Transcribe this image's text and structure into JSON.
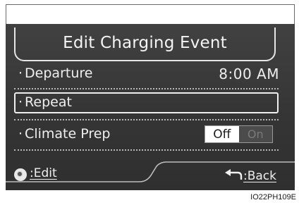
{
  "screen": {
    "title": "Edit Charging Event",
    "rows": [
      {
        "label": "Departure",
        "value": "8:00 AM"
      },
      {
        "label": "Repeat"
      },
      {
        "label": "Climate Prep",
        "toggle": {
          "off": "Off",
          "on": "On",
          "selected": "Off"
        }
      }
    ],
    "bullet": "·",
    "footer": {
      "edit_label": ":Edit",
      "back_label": ":Back"
    }
  },
  "figure_code": "IO22PH109E",
  "colors": {
    "screen_bg": "#3a3a3a",
    "text": "#efefef",
    "toggle_selected_bg": "#ffffff"
  },
  "icons": {
    "edit": "dial-knob-icon",
    "back": "back-arrow-icon"
  }
}
